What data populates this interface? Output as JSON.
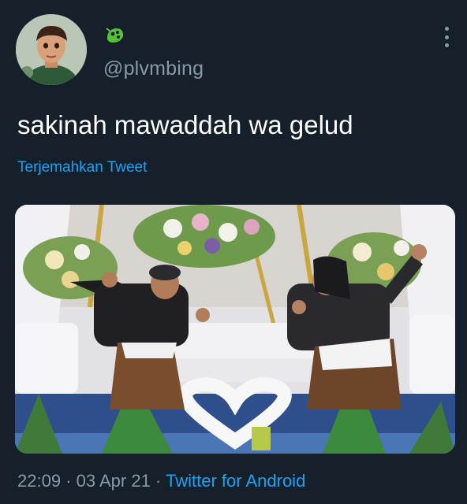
{
  "tweet": {
    "handle": "@plvmbing",
    "text": "sakinah mawaddah wa gelud",
    "translate_label": "Terjemahkan Tweet",
    "time": "22:09",
    "date": "03 Apr 21",
    "separator": "·",
    "source": "Twitter for Android"
  },
  "icons": {
    "avatar": "profile-avatar",
    "badge": "green-emoji-badge",
    "more": "vertical-ellipsis-icon"
  },
  "colors": {
    "background": "#15202b",
    "text": "#ffffff",
    "muted": "#8899a6",
    "link": "#1da1f2"
  }
}
